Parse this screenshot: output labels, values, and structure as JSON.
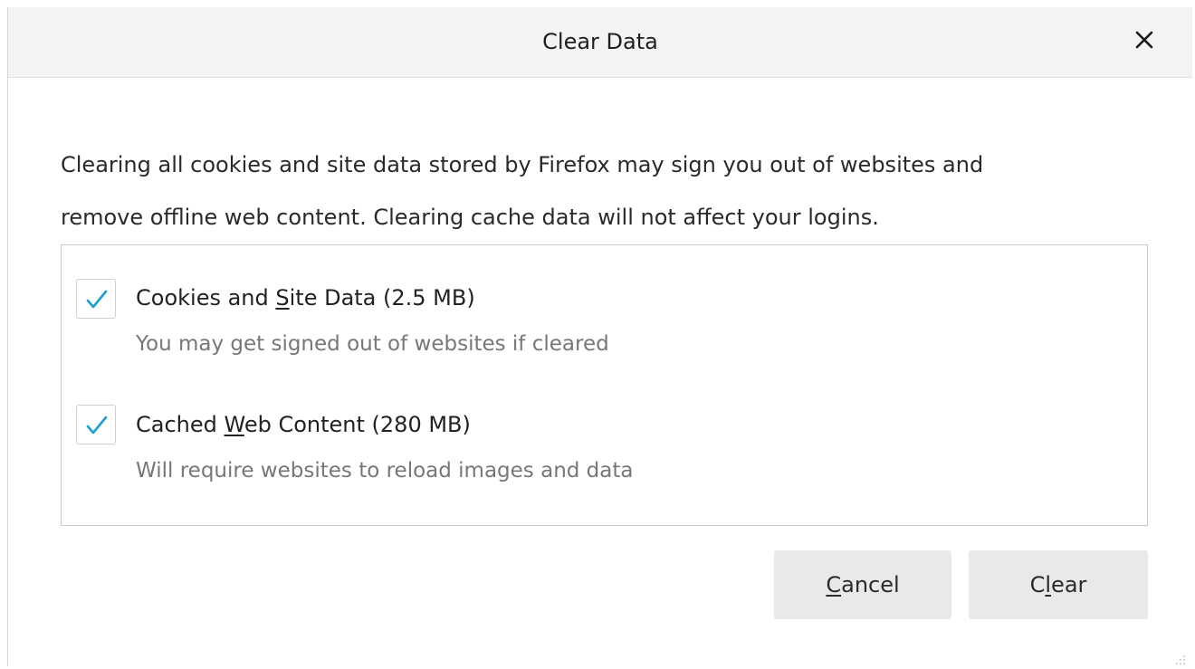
{
  "dialog": {
    "title": "Clear Data",
    "close_icon": "close-icon",
    "description_line1": "Clearing all cookies and site data stored by Firefox may sign you out of websites and",
    "description_line2": "remove offline web content. Clearing cache data will not affect your logins."
  },
  "options": [
    {
      "label_before": "Cookies and ",
      "label_mnemonic": "S",
      "label_after": "ite Data (2.5 MB)",
      "description": "You may get signed out of websites if cleared",
      "checked": true
    },
    {
      "label_before": "Cached ",
      "label_mnemonic": "W",
      "label_after": "eb Content (280 MB)",
      "description": "Will require websites to reload images and data",
      "checked": true
    }
  ],
  "buttons": {
    "cancel_mnemonic": "C",
    "cancel_rest": "ancel",
    "clear_before": "C",
    "clear_mnemonic": "l",
    "clear_after": "ear"
  },
  "colors": {
    "checkmark": "#1a9fd0",
    "titlebar": "#f3f3f3",
    "button": "#e9e9ec"
  }
}
